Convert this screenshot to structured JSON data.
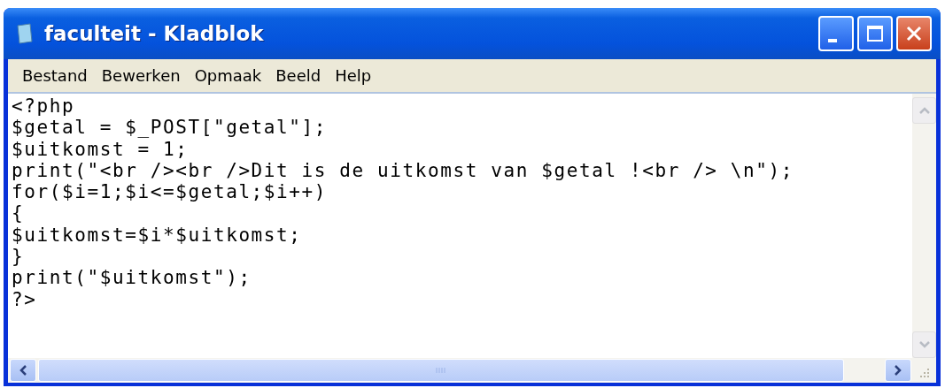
{
  "window": {
    "title": "faculteit - Kladblok"
  },
  "menu": [
    {
      "label": "Bestand"
    },
    {
      "label": "Bewerken"
    },
    {
      "label": "Opmaak"
    },
    {
      "label": "Beeld"
    },
    {
      "label": "Help"
    }
  ],
  "editor": {
    "lines": [
      "<?php",
      "$getal = $_POST[\"getal\"];",
      "$uitkomst = 1;",
      "print(\"<br /><br />Dit is de uitkomst van $getal !<br /> \\n\");",
      "for($i=1;$i<=$getal;$i++)",
      "{",
      "$uitkomst=$i*$uitkomst;",
      "}",
      "print(\"$uitkomst\");",
      "?>"
    ]
  }
}
